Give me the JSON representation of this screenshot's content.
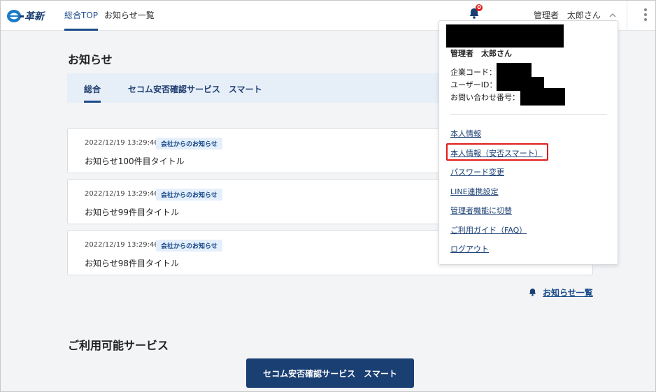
{
  "header": {
    "logo_text": "e-革新",
    "nav": [
      {
        "label": "総合TOP"
      },
      {
        "label": "お知らせ一覧"
      }
    ],
    "notification_count": "0",
    "user_role": "管理者",
    "user_name": "太郎さん"
  },
  "main": {
    "title": "お知らせ",
    "tabs": [
      {
        "label": "総合"
      },
      {
        "label": "セコム安否確認サービス　スマート"
      }
    ],
    "notices": [
      {
        "date": "2022/12/19 13:29:46",
        "tag": "会社からのお知らせ",
        "title": "お知らせ100件目タイトル"
      },
      {
        "date": "2022/12/19 13:29:46",
        "tag": "会社からのお知らせ",
        "title": "お知らせ99件目タイトル"
      },
      {
        "date": "2022/12/19 13:29:46",
        "tag": "会社からのお知らせ",
        "title": "お知らせ98件目タイトル"
      }
    ],
    "more_link": "お知らせ一覧",
    "services_title": "ご利用可能サービス",
    "service_button": "セコム安否確認サービス　スマート"
  },
  "dropdown": {
    "name": "管理者　太郎さん",
    "company_code_label": "企業コード：",
    "user_id_label": "ユーザーID：",
    "inquiry_label": "お問い合わせ番号：",
    "links": [
      "本人情報",
      "本人情報（安否スマート）",
      "パスワード変更",
      "LINE連携設定",
      "管理者機能に切替",
      "ご利用ガイド（FAQ）",
      "ログアウト"
    ]
  },
  "colors": {
    "primary": "#1a3f73",
    "accent": "#1a4a8a",
    "badge": "#e01b1b",
    "tab_bg": "#e6eef8",
    "page_bg": "#f2f4f6"
  }
}
